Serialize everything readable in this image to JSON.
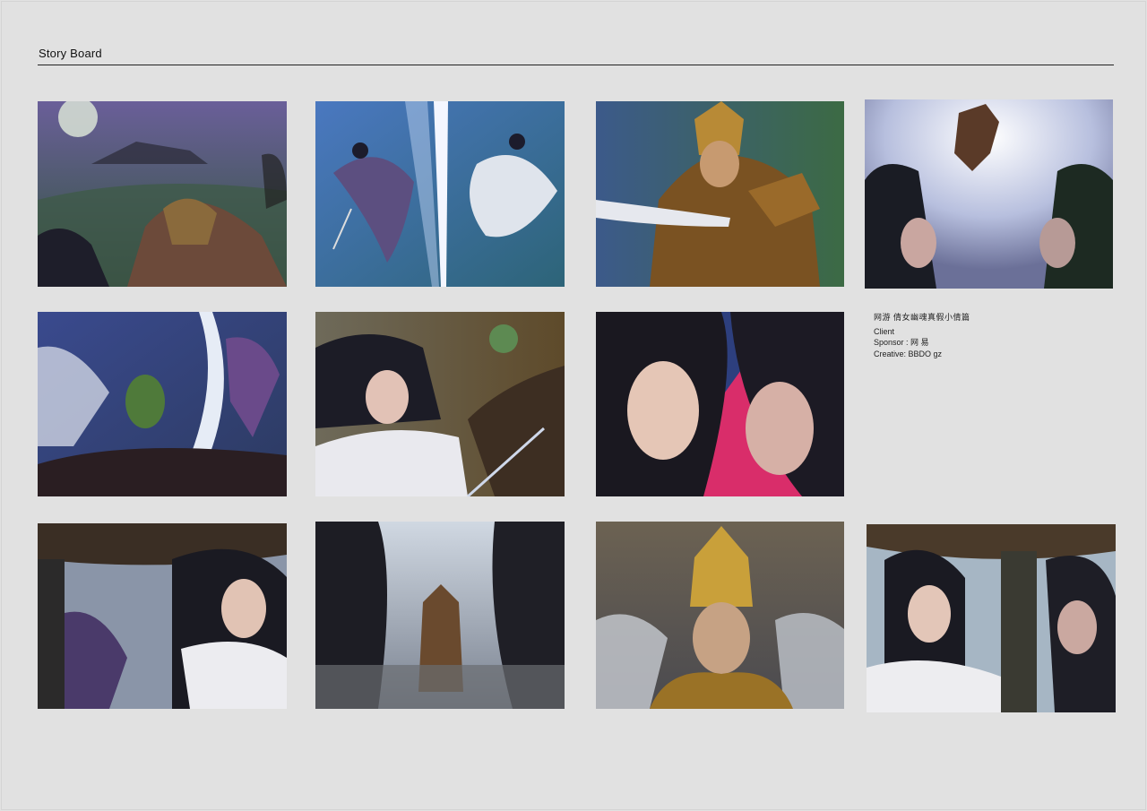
{
  "page": {
    "title": "Story Board"
  },
  "info": {
    "project": "网游  倩女幽魂真假小倩篇",
    "client": "Client",
    "sponsor": "Sponsor : 网 易",
    "creative": "Creative:  BBDO gz"
  },
  "panels": [
    {
      "icon": "moonlit-temple-battle-sketch"
    },
    {
      "icon": "flying-swordswomen-sketch"
    },
    {
      "icon": "armored-warrior-sketch"
    },
    {
      "icon": "leaping-warrior-sketch"
    },
    {
      "icon": "sword-clash-sketch"
    },
    {
      "icon": "heroine-reaching-sketch"
    },
    {
      "icon": "two-heroines-closeup-sketch"
    },
    {
      "icon": "heroine-under-eaves-sketch"
    },
    {
      "icon": "warrior-approaching-sketch"
    },
    {
      "icon": "golden-helmet-warrior-sketch"
    },
    {
      "icon": "heroines-facing-sketch"
    }
  ]
}
